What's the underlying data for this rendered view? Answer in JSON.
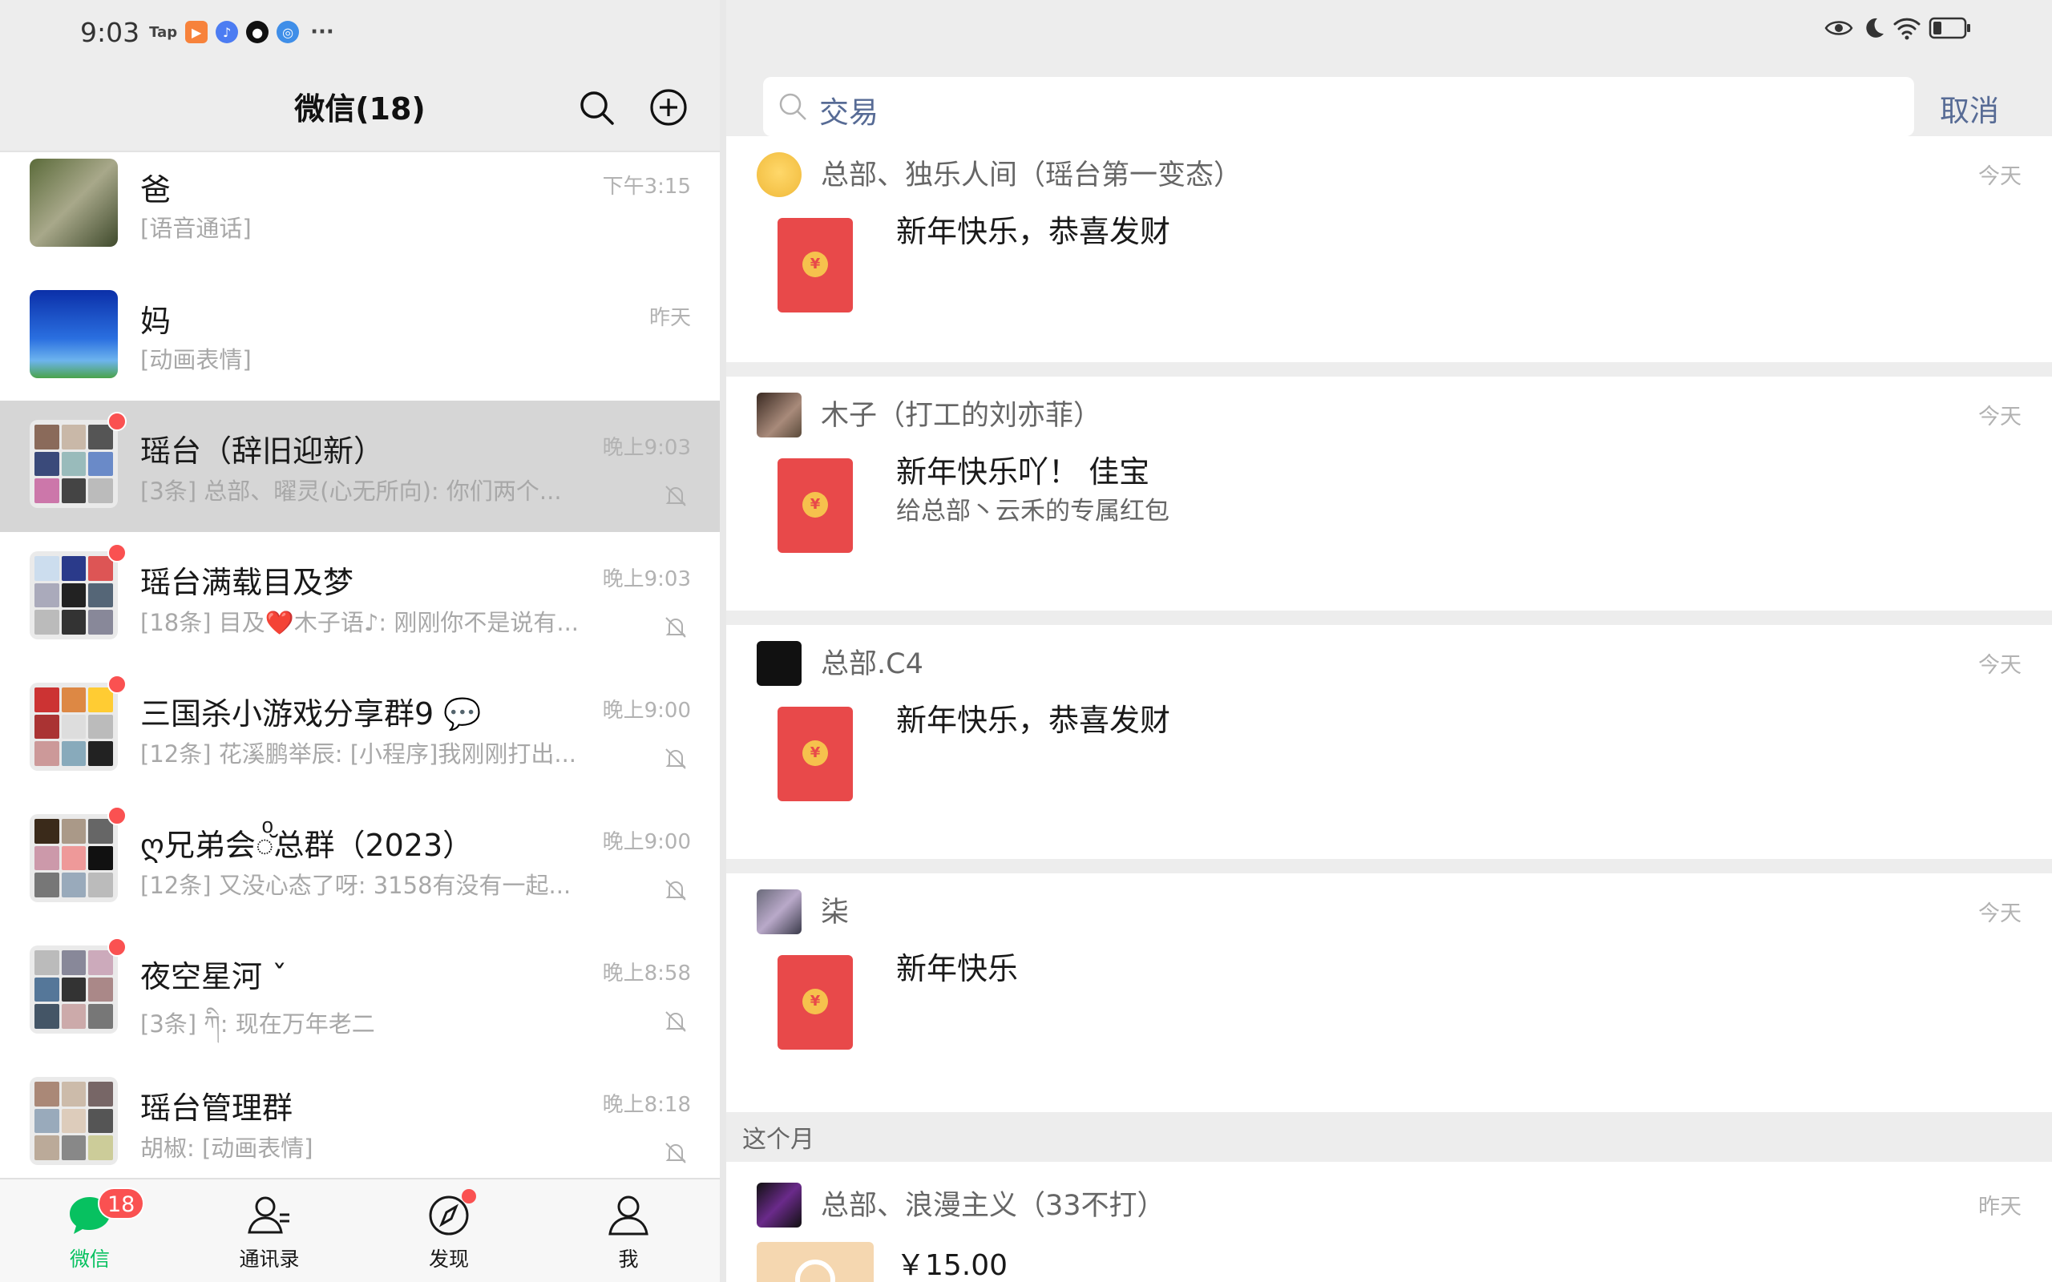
{
  "status_bar": {
    "time": "9:03",
    "tap_label": "Tap",
    "more": "···"
  },
  "left_header": {
    "title": "微信(18)"
  },
  "chats": [
    {
      "name": "爸",
      "preview": "[语音通话]",
      "time": "下午3:15",
      "unread_dot": false,
      "muted": false,
      "selected": false
    },
    {
      "name": "妈",
      "preview": "[动画表情]",
      "time": "昨天",
      "unread_dot": false,
      "muted": false,
      "selected": false
    },
    {
      "name": "瑶台（辞旧迎新）",
      "preview": "[3条] 总部、曜灵(心无所向): 你们两个...",
      "time": "晚上9:03",
      "unread_dot": true,
      "muted": true,
      "selected": true
    },
    {
      "name": "瑶台满载目及梦",
      "preview": "[18条] 目及❤️木子语♪: 刚刚你不是说有...",
      "time": "晚上9:03",
      "unread_dot": true,
      "muted": true,
      "selected": false
    },
    {
      "name": "三国杀小游戏分享群9 💬",
      "preview": "[12条] 花溪鹏举辰: [小程序]我刚刚打出...",
      "time": "晚上9:00",
      "unread_dot": true,
      "muted": true,
      "selected": false
    },
    {
      "name": "ღ兄弟会◌ͦ̆总群（2023）",
      "preview": "[12条] 又没心态了呀: 3158有没有一起...",
      "time": "晚上9:00",
      "unread_dot": true,
      "muted": true,
      "selected": false
    },
    {
      "name": "  夜空星河  ˇ",
      "preview": "[3条] ཀི: 现在万年老二",
      "time": "晚上8:58",
      "unread_dot": true,
      "muted": true,
      "selected": false
    },
    {
      "name": "瑶台管理群",
      "preview": "胡椒: [动画表情]",
      "time": "晚上8:18",
      "unread_dot": false,
      "muted": true,
      "selected": false
    }
  ],
  "tabbar": {
    "tabs": [
      {
        "label": "微信",
        "badge": "18"
      },
      {
        "label": "通讯录"
      },
      {
        "label": "发现"
      },
      {
        "label": "我"
      }
    ]
  },
  "search": {
    "query": "交易",
    "cancel_label": "取消"
  },
  "results": [
    {
      "sender": "总部、独乐人间（瑶台第一变态）",
      "time": "今天",
      "message": "新年快乐，恭喜发财",
      "sub": "",
      "type": "red-packet"
    },
    {
      "sender": "木子（打工的刘亦菲）",
      "time": "今天",
      "message": "新年快乐吖！ 佳宝",
      "sub": "给总部丶云禾的专属红包",
      "type": "red-packet"
    },
    {
      "sender": "总部.C4",
      "time": "今天",
      "message": "新年快乐，恭喜发财",
      "sub": "",
      "type": "red-packet"
    },
    {
      "sender": "柒",
      "time": "今天",
      "message": "新年快乐",
      "sub": "",
      "type": "red-packet"
    }
  ],
  "section_this_month": "这个月",
  "last_result": {
    "sender": "总部、浪漫主义（33不打）",
    "time": "昨天",
    "amount": "￥15.00"
  },
  "colors": {
    "accent_green": "#07c160",
    "link_blue": "#576b95",
    "red": "#fa5151",
    "red_packet": "#e8494a"
  }
}
